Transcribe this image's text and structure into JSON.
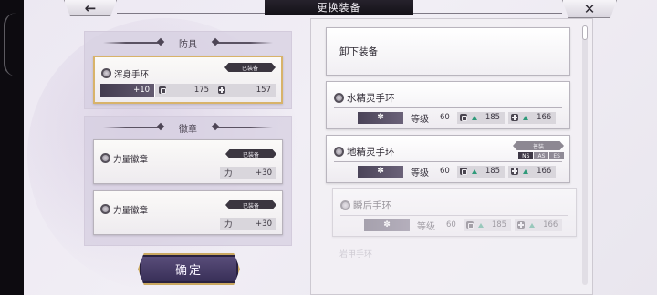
{
  "header": {
    "title": "更换装备",
    "back_icon": "arrow-left",
    "close_icon": "close-x"
  },
  "armor_group": {
    "title": "防具",
    "item": {
      "name": "浑身手环",
      "badge": "已装备",
      "enhance": "+10",
      "stat1": "175",
      "stat2": "157"
    }
  },
  "badge_group": {
    "title": "徽章",
    "items": [
      {
        "name": "力量徽章",
        "badge": "已装备",
        "stat_label": "力",
        "stat_value": "+30"
      },
      {
        "name": "力量徽章",
        "badge": "已装备",
        "stat_label": "力",
        "stat_value": "+30"
      }
    ]
  },
  "confirm_label": "确定",
  "list": {
    "unequip_label": "卸下装备",
    "level_label": "等级",
    "items": [
      {
        "name": "水精灵手环",
        "level": "60",
        "stat1": "185",
        "stat2": "166"
      },
      {
        "name": "地精灵手环",
        "level": "60",
        "stat1": "185",
        "stat2": "166",
        "status": "普装",
        "tags": [
          "NS",
          "AS",
          "ES"
        ]
      },
      {
        "name": "瞬后手环",
        "level": "60",
        "stat1": "185",
        "stat2": "166"
      }
    ],
    "partial_item_name": "岩甲手环"
  },
  "colors": {
    "accent_gold": "#caa860",
    "button_purple": "#4a3f6b",
    "up_arrow_green": "#2f9a7a"
  }
}
